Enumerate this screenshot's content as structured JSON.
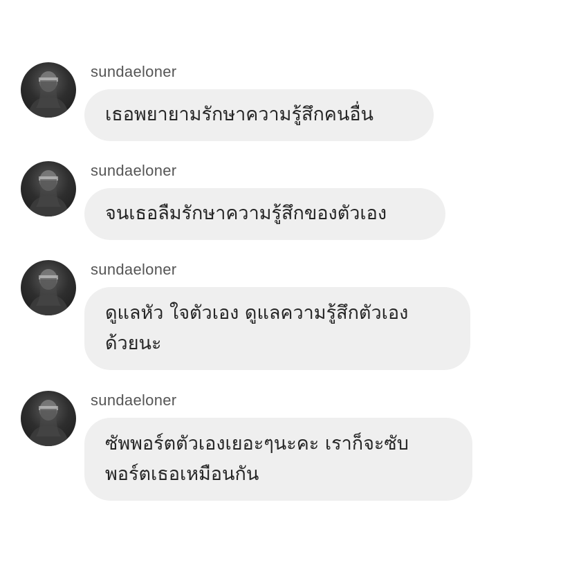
{
  "messages": [
    {
      "username": "sundaeloner",
      "text": "เธอพยายามรักษาความรู้สึกคนอื่น",
      "avatar_icon": "profile-photo-icon"
    },
    {
      "username": "sundaeloner",
      "text": "จนเธอลืมรักษาความรู้สึกของตัวเอง",
      "avatar_icon": "profile-photo-icon"
    },
    {
      "username": "sundaeloner",
      "text": "ดูแลหัว ใจตัวเอง ดูแลความรู้สึกตัวเอง\nด้วยนะ",
      "avatar_icon": "profile-photo-icon"
    },
    {
      "username": "sundaeloner",
      "text": "ซัพพอร์ตตัวเองเยอะๆนะคะ เราก็จะซับ\nพอร์ตเธอเหมือนกัน",
      "avatar_icon": "profile-photo-icon"
    }
  ],
  "colors": {
    "bubble_background": "#efefef",
    "text": "#262626",
    "username": "#555555",
    "page_background": "#ffffff"
  }
}
